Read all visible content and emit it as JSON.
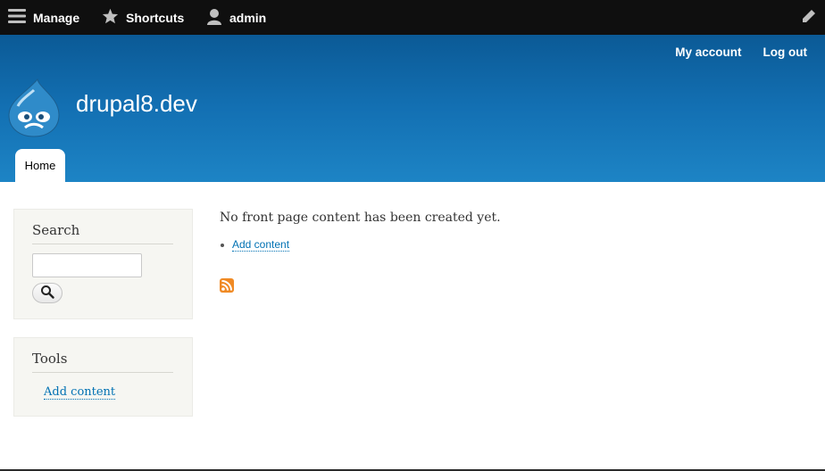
{
  "toolbar": {
    "manage_label": "Manage",
    "shortcuts_label": "Shortcuts",
    "user_label": "admin"
  },
  "header": {
    "account_label": "My account",
    "logout_label": "Log out",
    "site_name": "drupal8.dev",
    "tabs": [
      {
        "label": "Home"
      }
    ],
    "colors": {
      "gradient_top": "#0b5a96",
      "gradient_bottom": "#1d84c5"
    }
  },
  "sidebar": {
    "search": {
      "title": "Search",
      "input_value": ""
    },
    "tools": {
      "title": "Tools",
      "link_label": "Add content"
    }
  },
  "main": {
    "message": "No front page content has been created yet.",
    "links": [
      {
        "label": "Add content"
      }
    ]
  },
  "icons": {
    "toolbar_manage": "hamburger-icon",
    "toolbar_shortcuts": "star-icon",
    "toolbar_user": "user-icon",
    "toolbar_edit": "pencil-icon",
    "search_button": "magnifier-icon",
    "feed": "rss-icon"
  }
}
